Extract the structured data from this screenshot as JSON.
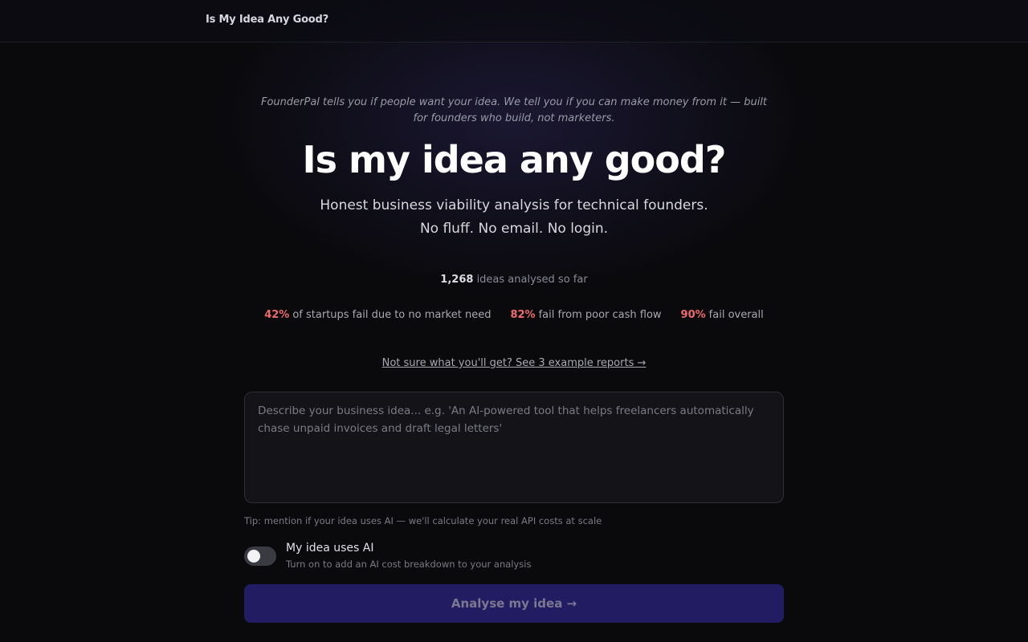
{
  "header": {
    "brand": "Is My Idea Any Good?"
  },
  "hero": {
    "intro": "FounderPal tells you if people want your idea. We tell you if you can make money from it — built for founders who build, not marketers.",
    "title": "Is my idea any good?",
    "subtitle_line1": "Honest business viability analysis for technical founders.",
    "subtitle_line2": "No fluff. No email. No login."
  },
  "counter": {
    "value": "1,268",
    "label": "ideas analysed so far"
  },
  "stats": [
    {
      "pct": "42%",
      "text": "of startups fail due to no market need"
    },
    {
      "pct": "82%",
      "text": "fail from poor cash flow"
    },
    {
      "pct": "90%",
      "text": "fail overall"
    }
  ],
  "examples_link": "Not sure what you'll get? See 3 example reports →",
  "idea_input": {
    "value": "",
    "placeholder": "Describe your business idea... e.g. 'An AI-powered tool that helps freelancers automatically chase unpaid invoices and draft legal letters'"
  },
  "tip": "Tip: mention if your idea uses AI — we'll calculate your real API costs at scale",
  "ai_toggle": {
    "on": false,
    "label": "My idea uses AI",
    "help": "Turn on to add an AI cost breakdown to your analysis"
  },
  "submit_label": "Analyse my idea →",
  "colors": {
    "accent_red": "#ef6b6b",
    "button": "#221d63"
  }
}
